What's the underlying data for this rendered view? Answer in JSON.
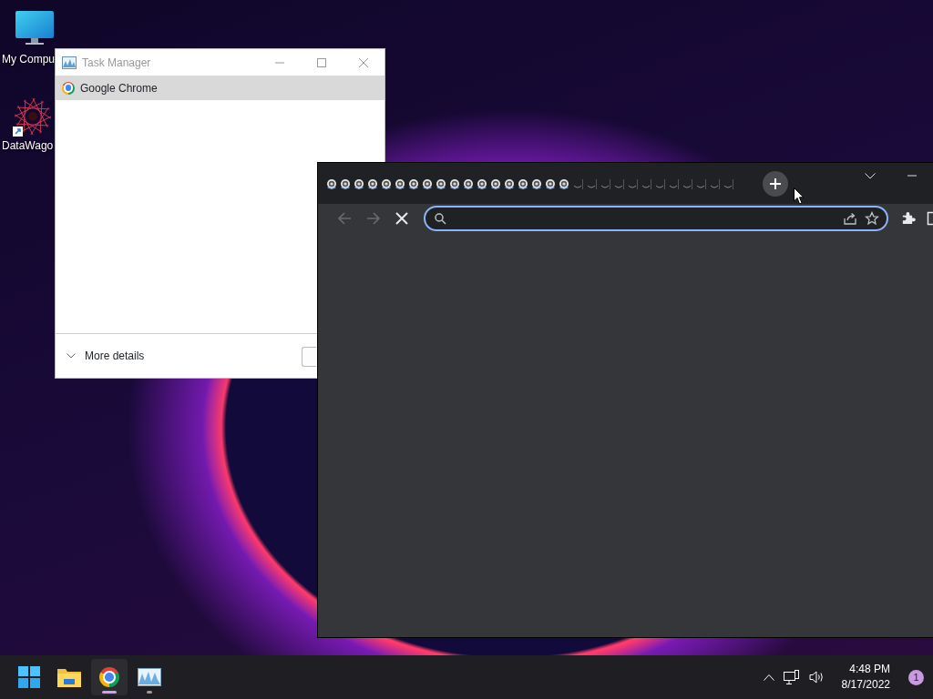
{
  "desktop_icons": [
    {
      "kind": "computer",
      "label": "My Compu"
    },
    {
      "kind": "app",
      "label": "DataWago"
    }
  ],
  "task_manager": {
    "title": "Task Manager",
    "apps": [
      {
        "name": "Google Chrome",
        "selected": true
      }
    ],
    "footer": {
      "label": "More details"
    }
  },
  "browser": {
    "tabs": [
      {
        "kind": "loading"
      },
      {
        "kind": "loading"
      },
      {
        "kind": "loading"
      },
      {
        "kind": "loading"
      },
      {
        "kind": "loading"
      },
      {
        "kind": "loading"
      },
      {
        "kind": "loading"
      },
      {
        "kind": "loading"
      },
      {
        "kind": "loading"
      },
      {
        "kind": "loading"
      },
      {
        "kind": "loading"
      },
      {
        "kind": "loading"
      },
      {
        "kind": "loading"
      },
      {
        "kind": "loading"
      },
      {
        "kind": "loading"
      },
      {
        "kind": "loading"
      },
      {
        "kind": "loading"
      },
      {
        "kind": "loading"
      },
      {
        "kind": "empty"
      },
      {
        "kind": "empty"
      },
      {
        "kind": "empty"
      },
      {
        "kind": "empty"
      },
      {
        "kind": "empty"
      },
      {
        "kind": "empty"
      },
      {
        "kind": "empty"
      },
      {
        "kind": "empty"
      },
      {
        "kind": "empty"
      },
      {
        "kind": "empty"
      },
      {
        "kind": "empty"
      },
      {
        "kind": "empty"
      }
    ],
    "back_disabled": true,
    "forward_disabled": true,
    "loading": true,
    "omnibox": {
      "focused": true
    }
  },
  "taskbar": {
    "apps": [
      {
        "kind": "start",
        "active": false,
        "running": false
      },
      {
        "kind": "explorer",
        "active": false,
        "running": false
      },
      {
        "kind": "chrome",
        "active": true,
        "running": true
      },
      {
        "kind": "taskmgr",
        "active": false,
        "running": true
      }
    ]
  },
  "tray": {
    "time": "4:48 PM",
    "date": "8/17/2022",
    "notifications": "1"
  }
}
